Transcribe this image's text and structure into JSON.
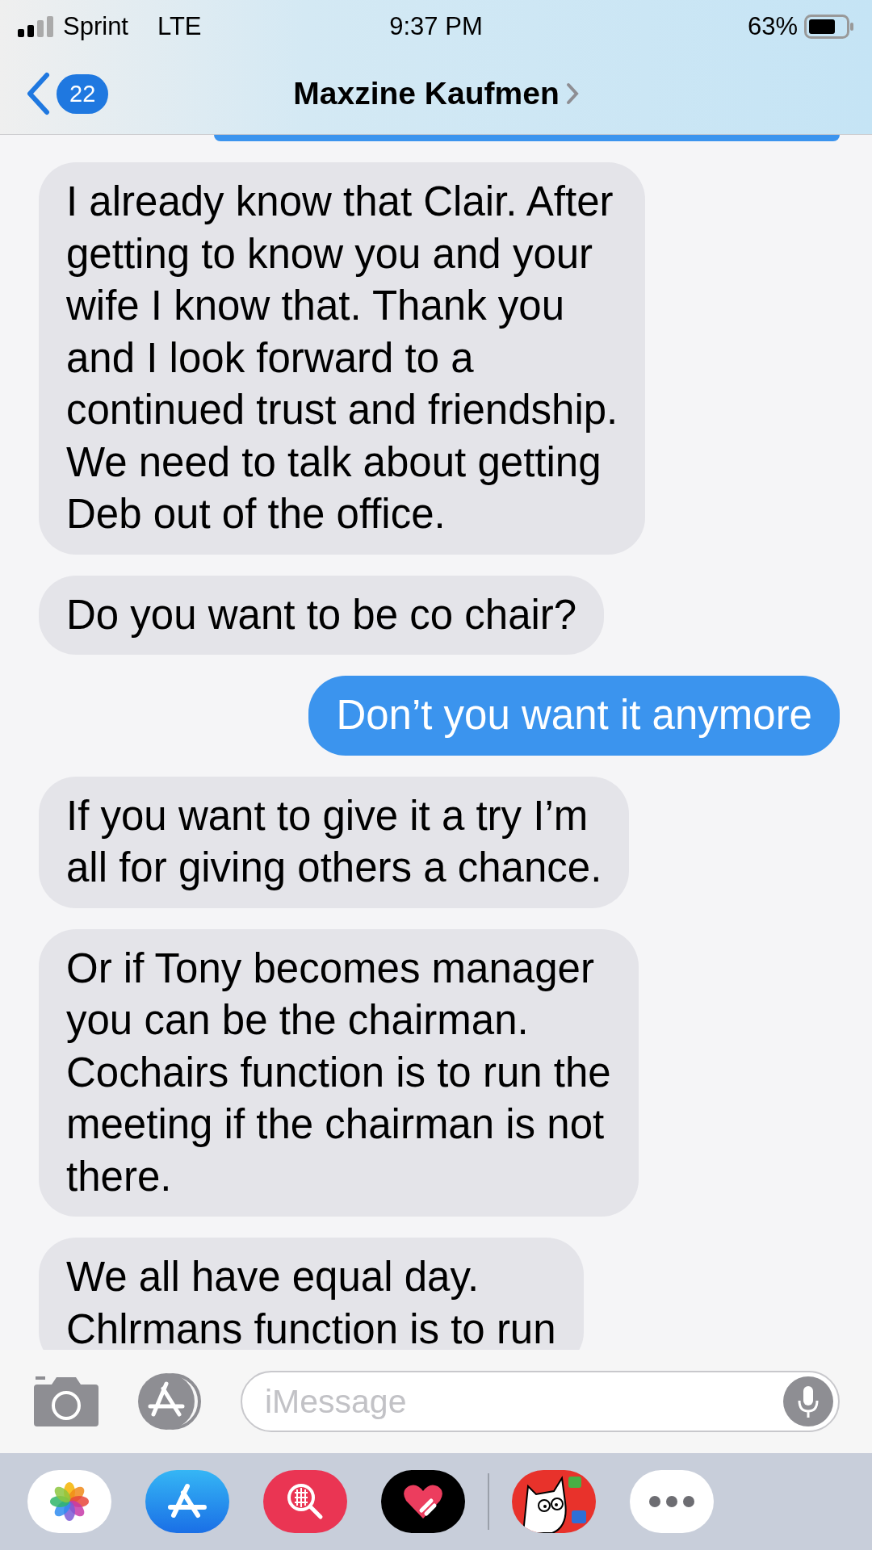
{
  "status_bar": {
    "carrier": "Sprint",
    "network": "LTE",
    "time": "9:37 PM",
    "battery": "63%"
  },
  "header": {
    "back_count": "22",
    "contact": "Maxzine Kaufmen"
  },
  "messages": [
    {
      "kind": "outgoing",
      "cut_off": true
    },
    {
      "kind": "incoming",
      "text": "I already know that Clair. After\ngetting to know you and your\nwife I know that. Thank you\nand I look forward to a\ncontinued trust and friendship.\nWe need to talk about getting\nDeb out of the office."
    },
    {
      "kind": "incoming",
      "text": "Do you want to be co chair?"
    },
    {
      "kind": "outgoing",
      "text": "Don’t you want it anymore"
    },
    {
      "kind": "incoming",
      "text": "If you want to give it a try I’m\nall for giving others a chance."
    },
    {
      "kind": "incoming",
      "text": "Or if Tony becomes manager\nyou can be the chairman.\nCochairs function is to run the\nmeeting if the chairman is not\nthere."
    },
    {
      "kind": "incoming",
      "text": "We all have equal day.\nChlrmans function is to run"
    }
  ],
  "composer": {
    "placeholder": "iMessage"
  },
  "app_drawer": [
    {
      "kind": "photos"
    },
    {
      "kind": "store"
    },
    {
      "kind": "search"
    },
    {
      "kind": "heart"
    },
    {
      "kind": "divider"
    },
    {
      "kind": "sticker"
    },
    {
      "kind": "more"
    }
  ]
}
